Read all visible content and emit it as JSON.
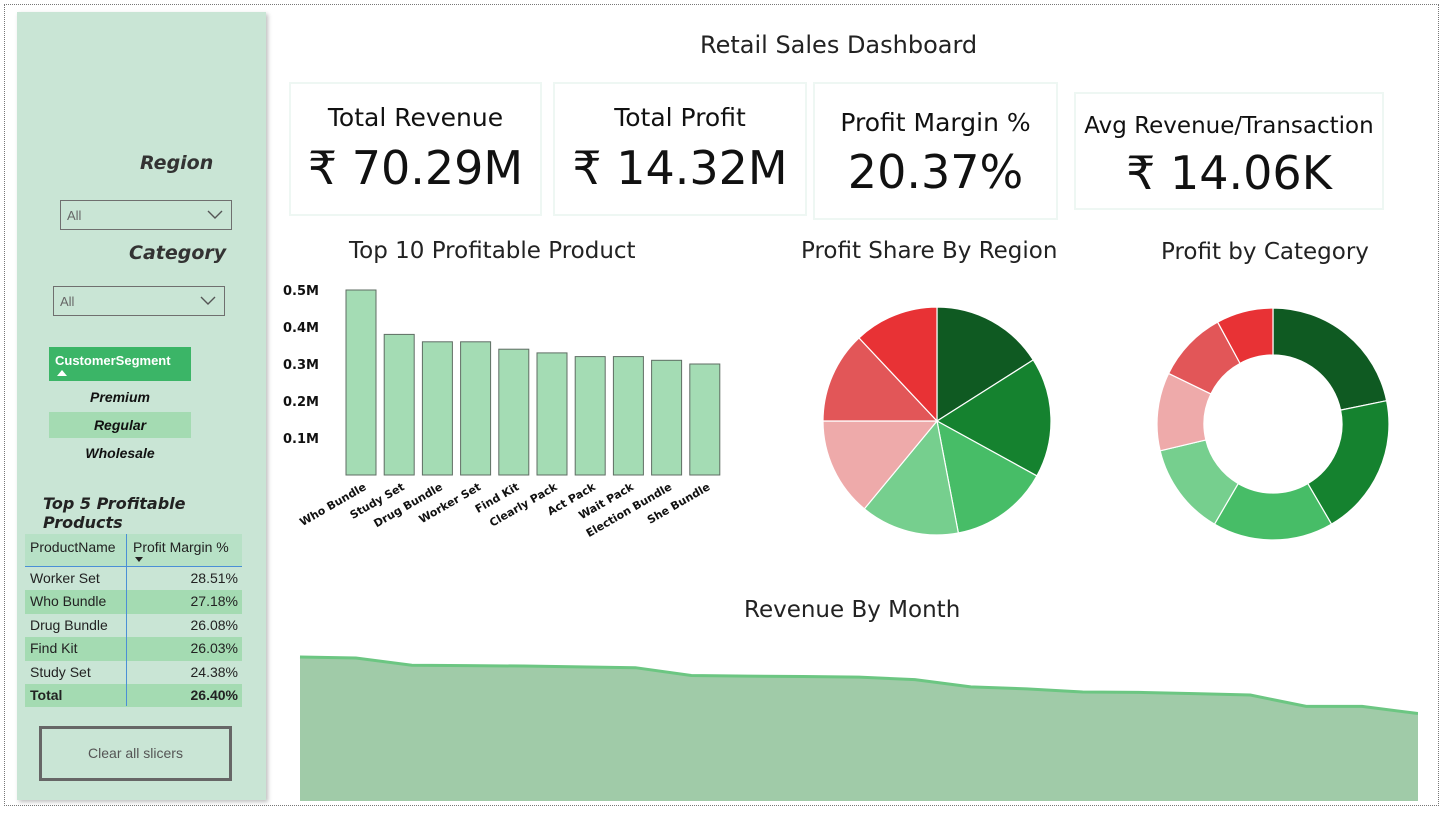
{
  "title": "Retail Sales Dashboard",
  "sidebar": {
    "region_title": "Region",
    "region_value": "All",
    "category_title": "Category",
    "category_value": "All",
    "segment_header": "CustomerSegment",
    "segments": [
      {
        "label": "Premium",
        "selected": false
      },
      {
        "label": "Regular",
        "selected": true
      },
      {
        "label": "Wholesale",
        "selected": false
      }
    ],
    "top5_title": "Top 5 Profitable Products",
    "table": {
      "headers": [
        "ProductName",
        "Profit Margin %"
      ],
      "rows": [
        [
          "Worker Set",
          "28.51%"
        ],
        [
          "Who Bundle",
          "27.18%"
        ],
        [
          "Drug Bundle",
          "26.08%"
        ],
        [
          "Find Kit",
          "26.03%"
        ],
        [
          "Study Set",
          "24.38%"
        ]
      ],
      "total": [
        "Total",
        "26.40%"
      ]
    },
    "clear_button": "Clear all slicers"
  },
  "kpis": [
    {
      "label": "Total Revenue",
      "value": "₹ 70.29M"
    },
    {
      "label": "Total Profit",
      "value": "₹ 14.32M"
    },
    {
      "label": "Profit Margin %",
      "value": "20.37%"
    },
    {
      "label": "Avg Revenue/Transaction",
      "value": "₹ 14.06K"
    }
  ],
  "charts": {
    "top10_title": "Top 10 Profitable Product",
    "region_title": "Profit Share By Region",
    "category_title": "Profit by Category",
    "month_title": "Revenue By Month"
  },
  "colors": {
    "sidebar_bg": "#c9e5d5",
    "accent": "#3bb567",
    "bar": "#a4dcb4",
    "area": "#a0cba8",
    "area_line": "#6cc682"
  },
  "chart_data": [
    {
      "type": "bar",
      "title": "Top 10 Profitable Product",
      "categories": [
        "Who Bundle",
        "Study Set",
        "Drug Bundle",
        "Worker Set",
        "Find Kit",
        "Clearly Pack",
        "Act Pack",
        "Wait Pack",
        "Election Bundle",
        "She Bundle"
      ],
      "values": [
        0.5,
        0.38,
        0.36,
        0.36,
        0.34,
        0.33,
        0.32,
        0.32,
        0.31,
        0.3
      ],
      "yticks": [
        "0.1M",
        "0.2M",
        "0.3M",
        "0.4M",
        "0.5M"
      ],
      "ylim": [
        0,
        0.5
      ]
    },
    {
      "type": "pie",
      "title": "Profit Share By Region",
      "values": [
        16,
        17,
        14,
        14,
        14,
        13,
        12
      ],
      "colors": [
        "#0f5a22",
        "#15822f",
        "#47bd67",
        "#76cf8e",
        "#eeaaaa",
        "#e25658",
        "#e83235"
      ]
    },
    {
      "type": "pie",
      "title": "Profit by Category",
      "donut": true,
      "values": [
        22,
        20,
        17,
        13,
        11,
        10,
        8
      ],
      "colors": [
        "#0f5a22",
        "#15822f",
        "#47bd67",
        "#76cf8e",
        "#eeaaaa",
        "#e25658",
        "#e83235"
      ]
    },
    {
      "type": "area",
      "title": "Revenue By Month",
      "values": [
        7.0,
        6.95,
        6.6,
        6.58,
        6.56,
        6.52,
        6.48,
        6.1,
        6.07,
        6.05,
        6.02,
        5.9,
        5.55,
        5.45,
        5.3,
        5.28,
        5.22,
        5.15,
        4.6,
        4.6,
        4.25
      ],
      "ylim": [
        0,
        7.0
      ]
    }
  ]
}
